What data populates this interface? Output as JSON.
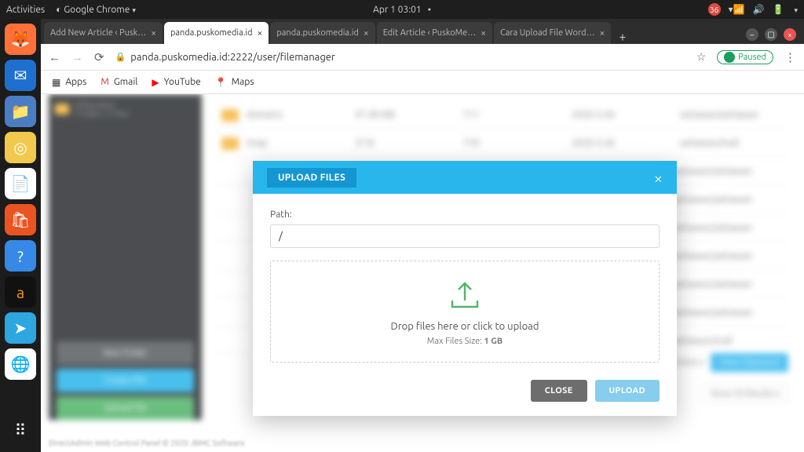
{
  "topbar": {
    "activities": "Activities",
    "app": "Google Chrome",
    "datetime": "Apr 1  03:01",
    "badge": "36"
  },
  "tabs": [
    {
      "title": "Add New Article ‹ Pusk…"
    },
    {
      "title": "panda.puskomedia.id"
    },
    {
      "title": "panda.puskomedia.id"
    },
    {
      "title": "Edit Article ‹ PuskoMe…"
    },
    {
      "title": "Cara Upload File Word…"
    }
  ],
  "url": "panda.puskomedia.id:2222/user/filemanager",
  "paused": "Paused",
  "bookmarks": {
    "apps": "Apps",
    "gmail": "Gmail",
    "youtube": "YouTube",
    "maps": "Maps"
  },
  "background": {
    "tree_name": "softaculous",
    "tree_sub": "3 Folders / 3 Files",
    "rows": [
      {
        "name": "domains",
        "size": "47.48 MB",
        "perm": "711",
        "date": "2020-3-28",
        "owner": "setiawan/setiawan"
      },
      {
        "name": "imap",
        "size": "37 B",
        "perm": "770",
        "date": "2020-3-28",
        "owner": "setiawan/mail"
      }
    ],
    "owner_more": "setiawan/setiawan",
    "owner_mail": "setiawan/mail",
    "btn_newfolder": "New Folder",
    "btn_createfile": "Create File",
    "btn_uploadfile": "Upload File",
    "clipboard_actions": "Clipboard Actions",
    "view_clipboard": "View Clipboard",
    "show_results": "Show 50 Results",
    "footer": "DirectAdmin Web Control Panel © 2020 JBMC Software"
  },
  "modal": {
    "title": "UPLOAD FILES",
    "path_label": "Path:",
    "path_value": "/",
    "drop_text": "Drop files here or click to upload",
    "max_label": "Max Files Size: ",
    "max_value": "1 GB",
    "close": "CLOSE",
    "upload": "UPLOAD"
  }
}
